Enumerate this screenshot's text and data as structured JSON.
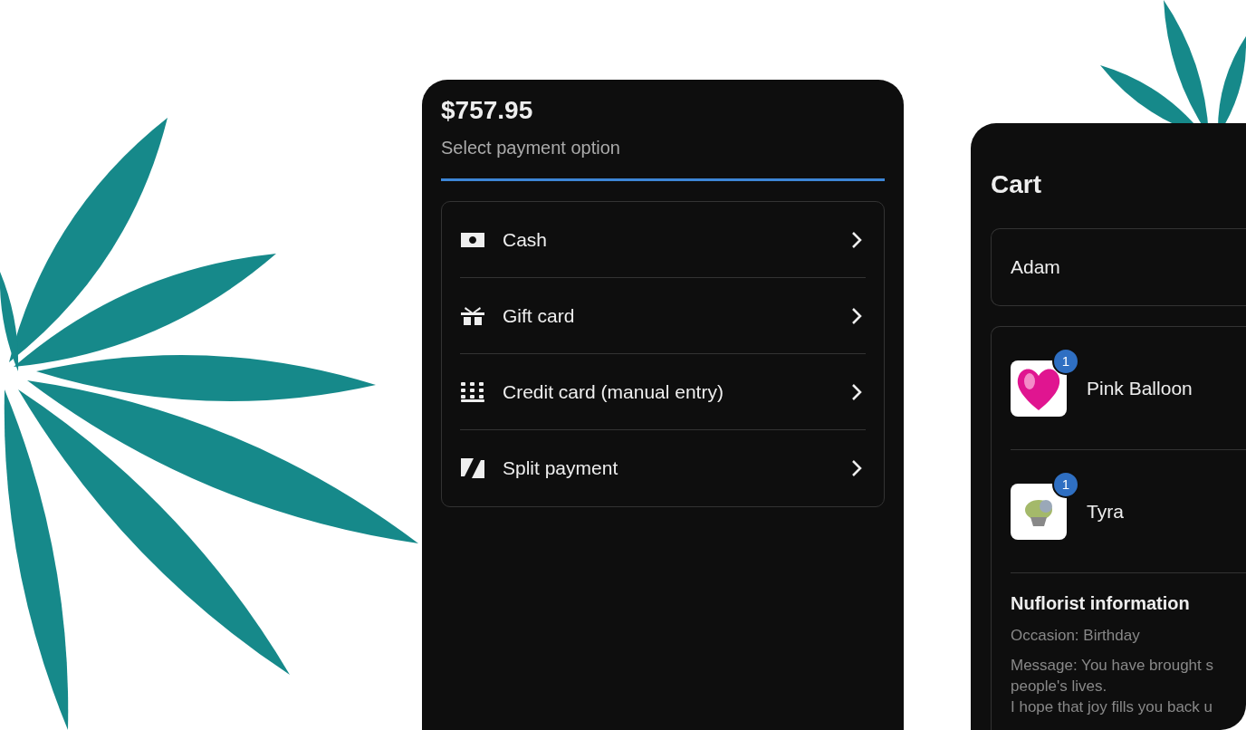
{
  "payment": {
    "total": "$757.95",
    "subtitle": "Select payment option",
    "progress": {
      "level": 1
    },
    "options": [
      {
        "kind": "cash",
        "label": "Cash"
      },
      {
        "kind": "gift",
        "label": "Gift card"
      },
      {
        "kind": "keypad",
        "label": "Credit card (manual entry)"
      },
      {
        "kind": "split",
        "label": "Split payment"
      }
    ]
  },
  "cart": {
    "title": "Cart",
    "customer": "Adam",
    "items": [
      {
        "kind": "balloon",
        "name": "Pink Balloon",
        "quantity": "1"
      },
      {
        "kind": "bouquet",
        "name": "Tyra",
        "quantity": "1"
      }
    ],
    "info": {
      "title": "Nuflorist information",
      "occasion": "Occasion: Birthday",
      "message": "Message: You have brought s\npeople's lives.\nI hope that joy fills you back u"
    }
  }
}
